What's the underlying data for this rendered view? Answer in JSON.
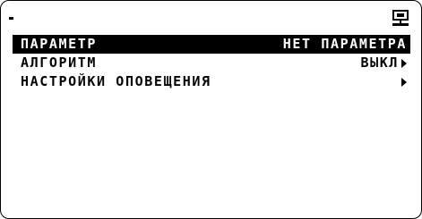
{
  "menu": {
    "items": [
      {
        "label": "ПАРАМЕТР",
        "value": "НЕТ ПАРАМЕТРА",
        "selected": true,
        "has_arrow": false
      },
      {
        "label": "АЛГОРИТМ",
        "value": "ВЫКЛ",
        "selected": false,
        "has_arrow": true
      },
      {
        "label": "НАСТРОЙКИ ОПОВЕЩЕНИЯ",
        "value": "",
        "selected": false,
        "has_arrow": true
      }
    ]
  },
  "icons": {
    "top_left": "dash-indicator",
    "top_right": "device-icon"
  },
  "colors": {
    "background": "#ffffff",
    "foreground": "#000000",
    "selection": "#000000"
  }
}
